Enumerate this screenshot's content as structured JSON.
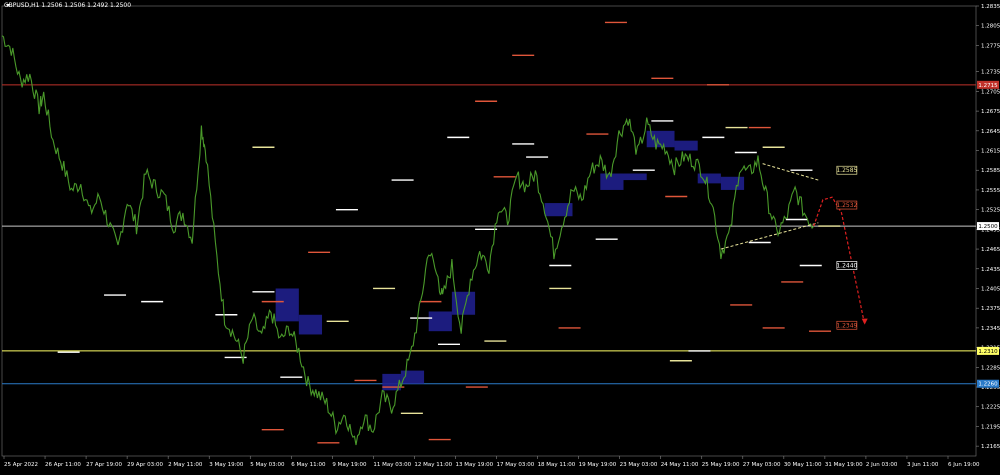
{
  "header": {
    "symbol_info": "GBPUSD,H1  1.2506 1.2506 1.2492 1.2500"
  },
  "colors": {
    "background": "#000000",
    "price_line": "#4a9a2a",
    "white_level": "#ffffff",
    "red_level": "#e0563a",
    "yellow_level": "#e8e39a",
    "blue_box": "#1f1f8c",
    "resistance": "#c0322a",
    "support_gray": "#c8c8c8",
    "support_yellow": "#ffff66",
    "support_blue": "#2a7ac8",
    "triangle": "#e8e39a",
    "projection": "#e02020"
  },
  "chart_data": {
    "type": "line",
    "title": "GBPUSD,H1",
    "ylim": [
      1.215,
      1.2835
    ],
    "y_ticks": [
      "1.2835",
      "1.2805",
      "1.2775",
      "1.2735",
      "1.2705",
      "1.2675",
      "1.2645",
      "1.2615",
      "1.2585",
      "1.2555",
      "1.2525",
      "1.2495",
      "1.2465",
      "1.2435",
      "1.2405",
      "1.2375",
      "1.2345",
      "1.2315",
      "1.2285",
      "1.2255",
      "1.2225",
      "1.2195",
      "1.2165"
    ],
    "x_ticks": [
      "25 Apr 2022",
      "26 Apr 11:00",
      "27 Apr 19:00",
      "29 Apr 03:00",
      "2 May 11:00",
      "3 May 19:00",
      "5 May 03:00",
      "6 May 11:00",
      "9 May 19:00",
      "11 May 03:00",
      "12 May 11:00",
      "13 May 19:00",
      "17 May 03:00",
      "18 May 11:00",
      "19 May 19:00",
      "23 May 03:00",
      "24 May 11:00",
      "25 May 19:00",
      "27 May 03:00",
      "30 May 11:00",
      "31 May 19:00",
      "2 Jun 03:00",
      "3 Jun 11:00",
      "6 Jun 19:00"
    ],
    "price_path": [
      [
        0,
        1.279
      ],
      [
        2,
        1.277
      ],
      [
        4,
        1.272
      ],
      [
        6,
        1.273
      ],
      [
        8,
        1.268
      ],
      [
        9,
        1.27
      ],
      [
        11,
        1.263
      ],
      [
        13,
        1.2595
      ],
      [
        15,
        1.2555
      ],
      [
        17,
        1.2565
      ],
      [
        19,
        1.252
      ],
      [
        21,
        1.2545
      ],
      [
        23,
        1.2505
      ],
      [
        25,
        1.2465
      ],
      [
        27,
        1.254
      ],
      [
        29,
        1.25
      ],
      [
        31,
        1.258
      ],
      [
        33,
        1.256
      ],
      [
        35,
        1.2545
      ],
      [
        37,
        1.25
      ],
      [
        39,
        1.252
      ],
      [
        41,
        1.248
      ],
      [
        43,
        1.265
      ],
      [
        44,
        1.261
      ],
      [
        46,
        1.247
      ],
      [
        48,
        1.236
      ],
      [
        50,
        1.2335
      ],
      [
        52,
        1.23
      ],
      [
        54,
        1.236
      ],
      [
        56,
        1.233
      ],
      [
        58,
        1.237
      ],
      [
        60,
        1.2325
      ],
      [
        62,
        1.2345
      ],
      [
        64,
        1.231
      ],
      [
        66,
        1.226
      ],
      [
        68,
        1.2245
      ],
      [
        70,
        1.223
      ],
      [
        72,
        1.2195
      ],
      [
        74,
        1.2215
      ],
      [
        76,
        1.217
      ],
      [
        78,
        1.221
      ],
      [
        80,
        1.219
      ],
      [
        82,
        1.224
      ],
      [
        84,
        1.2225
      ],
      [
        86,
        1.226
      ],
      [
        88,
        1.23
      ],
      [
        90,
        1.237
      ],
      [
        92,
        1.2465
      ],
      [
        94,
        1.242
      ],
      [
        95,
        1.239
      ],
      [
        97,
        1.244
      ],
      [
        99,
        1.234
      ],
      [
        101,
        1.242
      ],
      [
        103,
        1.246
      ],
      [
        105,
        1.244
      ],
      [
        107,
        1.253
      ],
      [
        109,
        1.251
      ],
      [
        111,
        1.2575
      ],
      [
        113,
        1.256
      ],
      [
        115,
        1.258
      ],
      [
        117,
        1.253
      ],
      [
        119,
        1.246
      ],
      [
        121,
        1.251
      ],
      [
        123,
        1.2555
      ],
      [
        125,
        1.254
      ],
      [
        127,
        1.2585
      ],
      [
        129,
        1.26
      ],
      [
        131,
        1.2575
      ],
      [
        133,
        1.264
      ],
      [
        135,
        1.2665
      ],
      [
        137,
        1.261
      ],
      [
        139,
        1.2655
      ],
      [
        141,
        1.2625
      ],
      [
        143,
        1.262
      ],
      [
        145,
        1.259
      ],
      [
        147,
        1.2605
      ],
      [
        149,
        1.26
      ],
      [
        151,
        1.2585
      ],
      [
        153,
        1.254
      ],
      [
        155,
        1.246
      ],
      [
        157,
        1.249
      ],
      [
        159,
        1.259
      ],
      [
        161,
        1.258
      ],
      [
        163,
        1.26
      ],
      [
        165,
        1.254
      ],
      [
        167,
        1.249
      ],
      [
        169,
        1.251
      ],
      [
        171,
        1.2555
      ],
      [
        173,
        1.252
      ],
      [
        175,
        1.25
      ]
    ],
    "resistance_level": {
      "label": "1.2715",
      "value": 1.2715
    },
    "support_levels": [
      {
        "label": "1.2500",
        "value": 1.25,
        "color": "#c8c8c8"
      },
      {
        "label": "1.2310",
        "value": 1.231,
        "color": "#ffff66"
      },
      {
        "label": "1.2260",
        "value": 1.226,
        "color": "#2a7ac8"
      }
    ],
    "boxed_labels": [
      {
        "label": "1.2585",
        "t": 180,
        "value": 1.2585,
        "color": "#e8e39a"
      },
      {
        "label": "1.2532",
        "t": 180,
        "value": 1.2532,
        "color": "#e0563a"
      },
      {
        "label": "1.2440",
        "t": 180,
        "value": 1.244,
        "color": "#ffffff"
      },
      {
        "label": "1.2349",
        "t": 180,
        "value": 1.2349,
        "color": "#e0563a"
      }
    ],
    "projection": [
      [
        175,
        1.25
      ],
      [
        177,
        1.254
      ],
      [
        179,
        1.2544
      ],
      [
        181,
        1.252
      ],
      [
        186,
        1.235
      ]
    ],
    "triangle": {
      "upper": [
        [
          164,
          1.2595
        ],
        [
          176,
          1.257
        ]
      ],
      "lower": [
        [
          155,
          1.2465
        ],
        [
          176,
          1.2505
        ]
      ]
    },
    "levels": {
      "white": [
        [
          12,
          1.2308
        ],
        [
          22,
          1.2395
        ],
        [
          30,
          1.2385
        ],
        [
          46,
          1.2365
        ],
        [
          54,
          1.24
        ],
        [
          72,
          1.2525
        ],
        [
          84,
          1.257
        ],
        [
          96,
          1.2635
        ],
        [
          118,
          1.244
        ],
        [
          128,
          1.248
        ],
        [
          136,
          1.2585
        ],
        [
          148,
          1.231
        ],
        [
          158,
          1.2612
        ],
        [
          170,
          1.2585
        ],
        [
          172,
          1.244
        ],
        [
          102,
          1.2495
        ],
        [
          88,
          1.236
        ],
        [
          48,
          1.23
        ],
        [
          60,
          1.227
        ],
        [
          94,
          1.232
        ],
        [
          110,
          1.2625
        ],
        [
          113,
          1.2605
        ],
        [
          140,
          1.266
        ],
        [
          151,
          1.2635
        ],
        [
          161,
          1.2475
        ],
        [
          169,
          1.251
        ]
      ],
      "red": [
        [
          56,
          1.2385
        ],
        [
          66,
          1.246
        ],
        [
          76,
          1.2265
        ],
        [
          90,
          1.2385
        ],
        [
          102,
          1.269
        ],
        [
          110,
          1.276
        ],
        [
          120,
          1.2345
        ],
        [
          130,
          1.281
        ],
        [
          140,
          1.2725
        ],
        [
          152,
          1.2715
        ],
        [
          164,
          1.2345
        ],
        [
          168,
          1.2415
        ],
        [
          174,
          1.234
        ],
        [
          56,
          1.219
        ],
        [
          68,
          1.217
        ],
        [
          82,
          1.2255
        ],
        [
          92,
          1.2175
        ],
        [
          100,
          1.2255
        ],
        [
          106,
          1.2575
        ],
        [
          126,
          1.264
        ],
        [
          143,
          1.2545
        ],
        [
          157,
          1.238
        ],
        [
          161,
          1.265
        ]
      ],
      "yellow": [
        [
          54,
          1.262
        ],
        [
          70,
          1.2355
        ],
        [
          80,
          1.2405
        ],
        [
          86,
          1.2215
        ],
        [
          104,
          1.2325
        ],
        [
          118,
          1.2405
        ],
        [
          144,
          1.2295
        ],
        [
          156,
          1.265
        ],
        [
          164,
          1.262
        ],
        [
          176,
          1.25
        ]
      ]
    },
    "boxes": [
      {
        "t0": 59,
        "t1": 64,
        "v0": 1.2355,
        "v1": 1.2405
      },
      {
        "t0": 64,
        "t1": 69,
        "v0": 1.2335,
        "v1": 1.2365
      },
      {
        "t0": 92,
        "t1": 97,
        "v0": 1.234,
        "v1": 1.237
      },
      {
        "t0": 97,
        "t1": 102,
        "v0": 1.2365,
        "v1": 1.24
      },
      {
        "t0": 82,
        "t1": 86,
        "v0": 1.225,
        "v1": 1.2275
      },
      {
        "t0": 86,
        "t1": 91,
        "v0": 1.226,
        "v1": 1.228
      },
      {
        "t0": 117,
        "t1": 123,
        "v0": 1.2515,
        "v1": 1.2535
      },
      {
        "t0": 129,
        "t1": 134,
        "v0": 1.2555,
        "v1": 1.258
      },
      {
        "t0": 134,
        "t1": 139,
        "v0": 1.257,
        "v1": 1.258
      },
      {
        "t0": 139,
        "t1": 145,
        "v0": 1.262,
        "v1": 1.2645
      },
      {
        "t0": 145,
        "t1": 150,
        "v0": 1.2615,
        "v1": 1.263
      },
      {
        "t0": 150,
        "t1": 155,
        "v0": 1.2565,
        "v1": 1.258
      },
      {
        "t0": 155,
        "t1": 160,
        "v0": 1.2555,
        "v1": 1.2575
      }
    ],
    "t_range": [
      0,
      210
    ],
    "grid": false
  }
}
